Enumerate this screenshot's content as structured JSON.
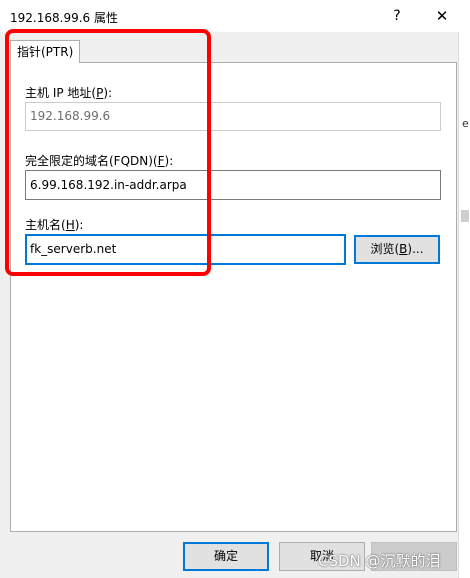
{
  "window": {
    "title": "192.168.99.6 属性",
    "help_label": "?",
    "close_label": "✕"
  },
  "tab": {
    "label": "指针(PTR)"
  },
  "fields": {
    "host_ip": {
      "label": "主机 IP 地址(",
      "key": "P",
      "suffix": "):",
      "value": "192.168.99.6"
    },
    "fqdn": {
      "label": "完全限定的域名(FQDN)(",
      "key": "F",
      "suffix": "):",
      "value": "6.99.168.192.in-addr.arpa"
    },
    "host_name": {
      "label": "主机名(",
      "key": "H",
      "suffix": "):",
      "value": "fk_serverb.net"
    }
  },
  "buttons": {
    "browse": {
      "label": "浏览(",
      "key": "B",
      "suffix": ")..."
    },
    "ok": "确定",
    "cancel": "取消"
  },
  "edge": {
    "mark": "e"
  },
  "watermark": "CSDN @沉默的泪",
  "colors": {
    "highlight": "#ff0000",
    "focus": "#0078d7"
  },
  "icons": [
    "help-icon",
    "close-icon"
  ]
}
